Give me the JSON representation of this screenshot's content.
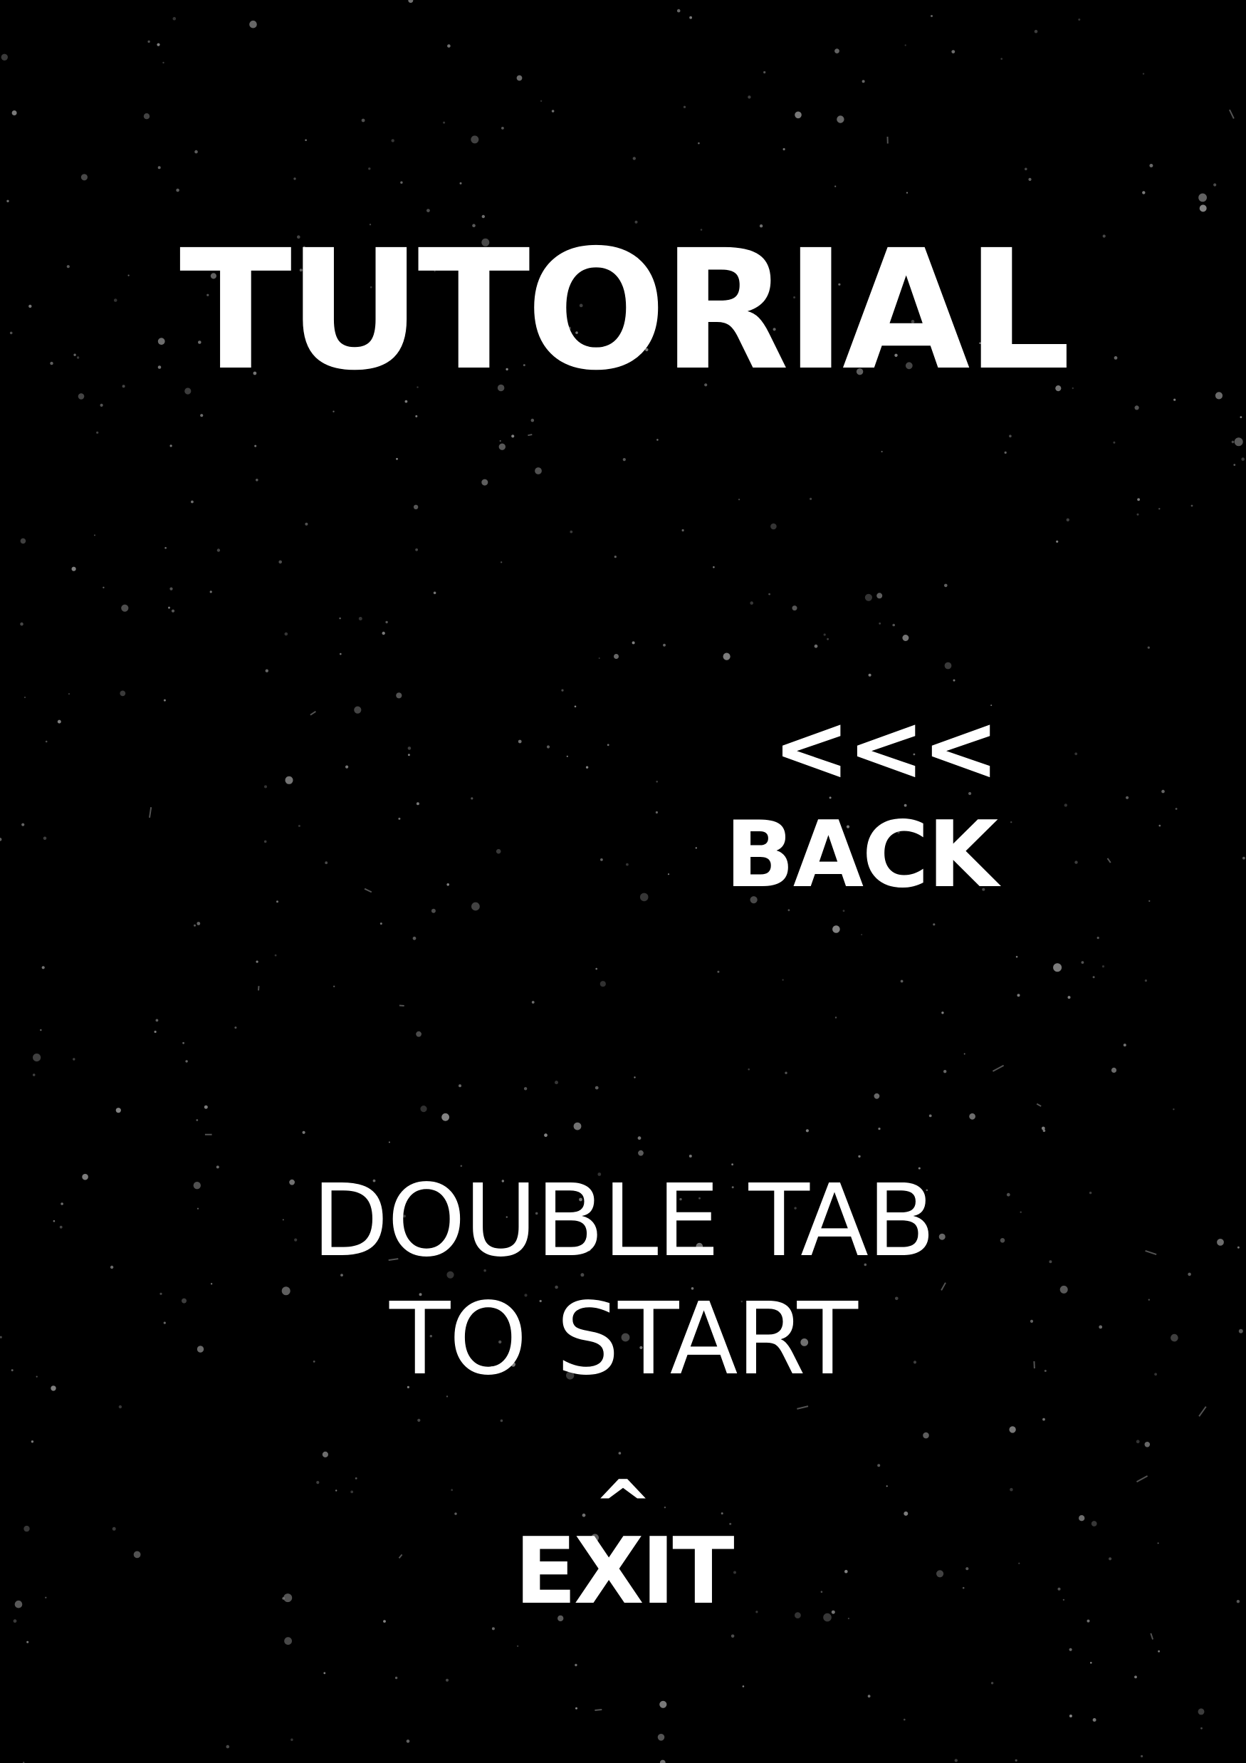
{
  "screen": {
    "title": "TUTORIAL",
    "background_color": "#000000",
    "text_color": "#ffffff",
    "star_color": "#8a8a8a"
  },
  "back": {
    "arrows": "<<<",
    "label": "BACK"
  },
  "start_prompt": {
    "line1": "DOUBLE TAB",
    "line2": "TO START"
  },
  "exit": {
    "caret": "^",
    "label": "EXIT"
  }
}
